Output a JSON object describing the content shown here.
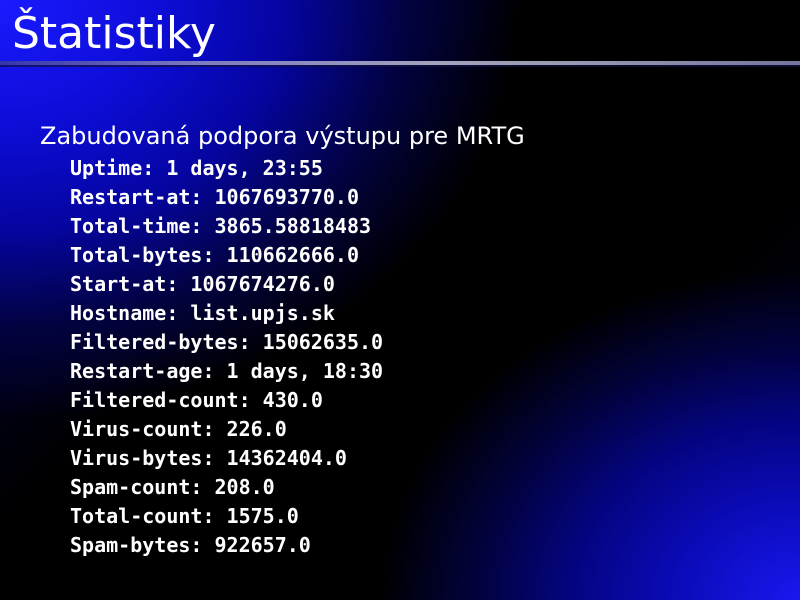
{
  "slide": {
    "title": "Štatistiky",
    "heading": "Zabudovaná podpora výstupu pre MRTG",
    "stats": [
      {
        "key": "Uptime",
        "value": "1 days, 23:55"
      },
      {
        "key": "Restart-at",
        "value": "1067693770.0"
      },
      {
        "key": "Total-time",
        "value": "3865.58818483"
      },
      {
        "key": "Total-bytes",
        "value": "110662666.0"
      },
      {
        "key": "Start-at",
        "value": "1067674276.0"
      },
      {
        "key": "Hostname",
        "value": "list.upjs.sk"
      },
      {
        "key": "Filtered-bytes",
        "value": "15062635.0"
      },
      {
        "key": "Restart-age",
        "value": "1 days, 18:30"
      },
      {
        "key": "Filtered-count",
        "value": "430.0"
      },
      {
        "key": "Virus-count",
        "value": "226.0"
      },
      {
        "key": "Virus-bytes",
        "value": "14362404.0"
      },
      {
        "key": "Spam-count",
        "value": "208.0"
      },
      {
        "key": "Total-count",
        "value": "1575.0"
      },
      {
        "key": "Spam-bytes",
        "value": "922657.0"
      }
    ],
    "colors": {
      "background": "#000000",
      "accent_blue": "#1a1aff",
      "text": "#ffffff"
    }
  }
}
